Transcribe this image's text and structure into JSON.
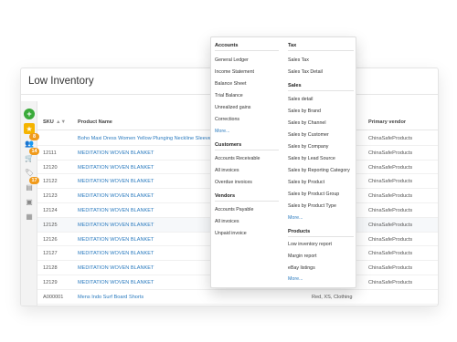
{
  "page": {
    "title": "Low Inventory"
  },
  "rail": {
    "items": [
      {
        "name": "add",
        "glyph": "+"
      },
      {
        "name": "star",
        "glyph": "★"
      },
      {
        "name": "users",
        "glyph": "👥",
        "badge": "8"
      },
      {
        "name": "cart",
        "glyph": "🛒",
        "badge": "14"
      },
      {
        "name": "tag",
        "glyph": "🏷",
        "badge": ""
      },
      {
        "name": "report",
        "glyph": "▤",
        "badge": "17"
      },
      {
        "name": "box",
        "glyph": "▣",
        "badge": ""
      },
      {
        "name": "sales",
        "glyph": "▦",
        "badge": ""
      }
    ]
  },
  "table": {
    "headers": {
      "sku": "SKU",
      "sort": "▲▼",
      "name": "Product Name",
      "vendor": "Primary vendor"
    },
    "rows": [
      {
        "sku": "",
        "name": "Boho Maxi Dress Women Yellow Plunging Neckline Sleeve",
        "tags": "",
        "vendor": "ChinaSafeProducts"
      },
      {
        "sku": "12111",
        "name": "MEDITATION WOVEN BLANKET",
        "tags": "",
        "vendor": "ChinaSafeProducts"
      },
      {
        "sku": "12120",
        "name": "MEDITATION WOVEN BLANKET",
        "tags": "",
        "vendor": "ChinaSafeProducts"
      },
      {
        "sku": "12122",
        "name": "MEDITATION WOVEN BLANKET",
        "tags": "",
        "vendor": "ChinaSafeProducts"
      },
      {
        "sku": "12123",
        "name": "MEDITATION WOVEN BLANKET",
        "tags": "",
        "vendor": "ChinaSafeProducts"
      },
      {
        "sku": "12124",
        "name": "MEDITATION WOVEN BLANKET",
        "tags": "",
        "vendor": "ChinaSafeProducts"
      },
      {
        "sku": "12125",
        "name": "MEDITATION WOVEN BLANKET",
        "tags": "",
        "vendor": "ChinaSafeProducts"
      },
      {
        "sku": "12126",
        "name": "MEDITATION WOVEN BLANKET",
        "tags": "",
        "vendor": "ChinaSafeProducts"
      },
      {
        "sku": "12127",
        "name": "MEDITATION WOVEN BLANKET",
        "tags": "",
        "vendor": "ChinaSafeProducts"
      },
      {
        "sku": "12128",
        "name": "MEDITATION WOVEN BLANKET",
        "tags": "",
        "vendor": "ChinaSafeProducts"
      },
      {
        "sku": "12129",
        "name": "MEDITATION WOVEN BLANKET",
        "tags": "",
        "vendor": "ChinaSafeProducts"
      },
      {
        "sku": "A000001",
        "name": "Mens Indo Surf Board Shorts",
        "tags": "Red, XS, Clothing",
        "vendor": ""
      }
    ]
  },
  "menu": {
    "accounts": {
      "heading": "Accounts",
      "items": [
        "General Ledger",
        "Income Statement",
        "Balance Sheet",
        "Trial Balance",
        "Unrealized gains",
        "Corrections"
      ],
      "more": "More..."
    },
    "customers": {
      "heading": "Customers",
      "items": [
        "Accounts Receivable",
        "All invoices",
        "Overdue invoices"
      ]
    },
    "vendors": {
      "heading": "Vendors",
      "items": [
        "Accounts Payable",
        "All invoices",
        "Unpaid invoice"
      ]
    },
    "tax": {
      "heading": "Tax",
      "items": [
        "Sales Tax",
        "Sales Tax Detail"
      ]
    },
    "sales": {
      "heading": "Sales",
      "items": [
        "Sales detail",
        "Sales by Brand",
        "Sales by Channel",
        "Sales by Customer",
        "Sales by Company",
        "Sales by Lead Source",
        "Sales by Reporting Category",
        "Sales by Product",
        "Sales by Product Group",
        "Sales by Product Type"
      ],
      "more": "More..."
    },
    "products": {
      "heading": "Products",
      "items": [
        "Low inventory report",
        "Margin report",
        "eBay listings"
      ],
      "more": "More..."
    }
  },
  "colors": {
    "accent": "#2b7bbf",
    "add": "#3aaa3a",
    "active": "#f5b400",
    "badge": "#f09a1a"
  }
}
